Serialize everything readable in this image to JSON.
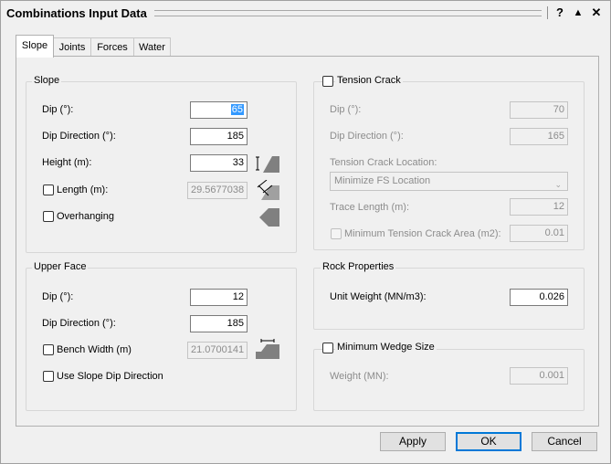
{
  "window": {
    "title": "Combinations Input Data",
    "help_label": "?",
    "collapse_label": "▲",
    "close_label": "✕"
  },
  "tabs": [
    {
      "label": "Slope",
      "active": true
    },
    {
      "label": "Joints",
      "active": false
    },
    {
      "label": "Forces",
      "active": false
    },
    {
      "label": "Water",
      "active": false
    }
  ],
  "slope": {
    "title": "Slope",
    "dip_label": "Dip (°):",
    "dip_value": "65",
    "dip_direction_label": "Dip Direction (°):",
    "dip_direction_value": "185",
    "height_label": "Height (m):",
    "height_value": "33",
    "length_label": "Length (m):",
    "length_value": "29.5677038",
    "overhanging_label": "Overhanging"
  },
  "upper_face": {
    "title": "Upper Face",
    "dip_label": "Dip (°):",
    "dip_value": "12",
    "dip_direction_label": "Dip Direction (°):",
    "dip_direction_value": "185",
    "bench_width_label": "Bench Width (m)",
    "bench_width_value": "21.0700141",
    "use_slope_dip_label": "Use Slope Dip Direction"
  },
  "tension_crack": {
    "title": "Tension Crack",
    "dip_label": "Dip (°):",
    "dip_value": "70",
    "dip_direction_label": "Dip Direction (°):",
    "dip_direction_value": "165",
    "location_label": "Tension Crack Location:",
    "location_value": "Minimize FS Location",
    "trace_length_label": "Trace Length (m):",
    "trace_length_value": "12",
    "min_area_label": "Minimum Tension Crack Area (m2):",
    "min_area_value": "0.01"
  },
  "rock_properties": {
    "title": "Rock Properties",
    "unit_weight_label": "Unit Weight (MN/m3):",
    "unit_weight_value": "0.026"
  },
  "min_wedge": {
    "title": "Minimum Wedge Size",
    "weight_label": "Weight (MN):",
    "weight_value": "0.001"
  },
  "buttons": {
    "apply": "Apply",
    "ok": "OK",
    "cancel": "Cancel"
  },
  "colors": {
    "selection": "#3399ff",
    "default_button_border": "#0078d7",
    "icon_fill": "#808080"
  }
}
